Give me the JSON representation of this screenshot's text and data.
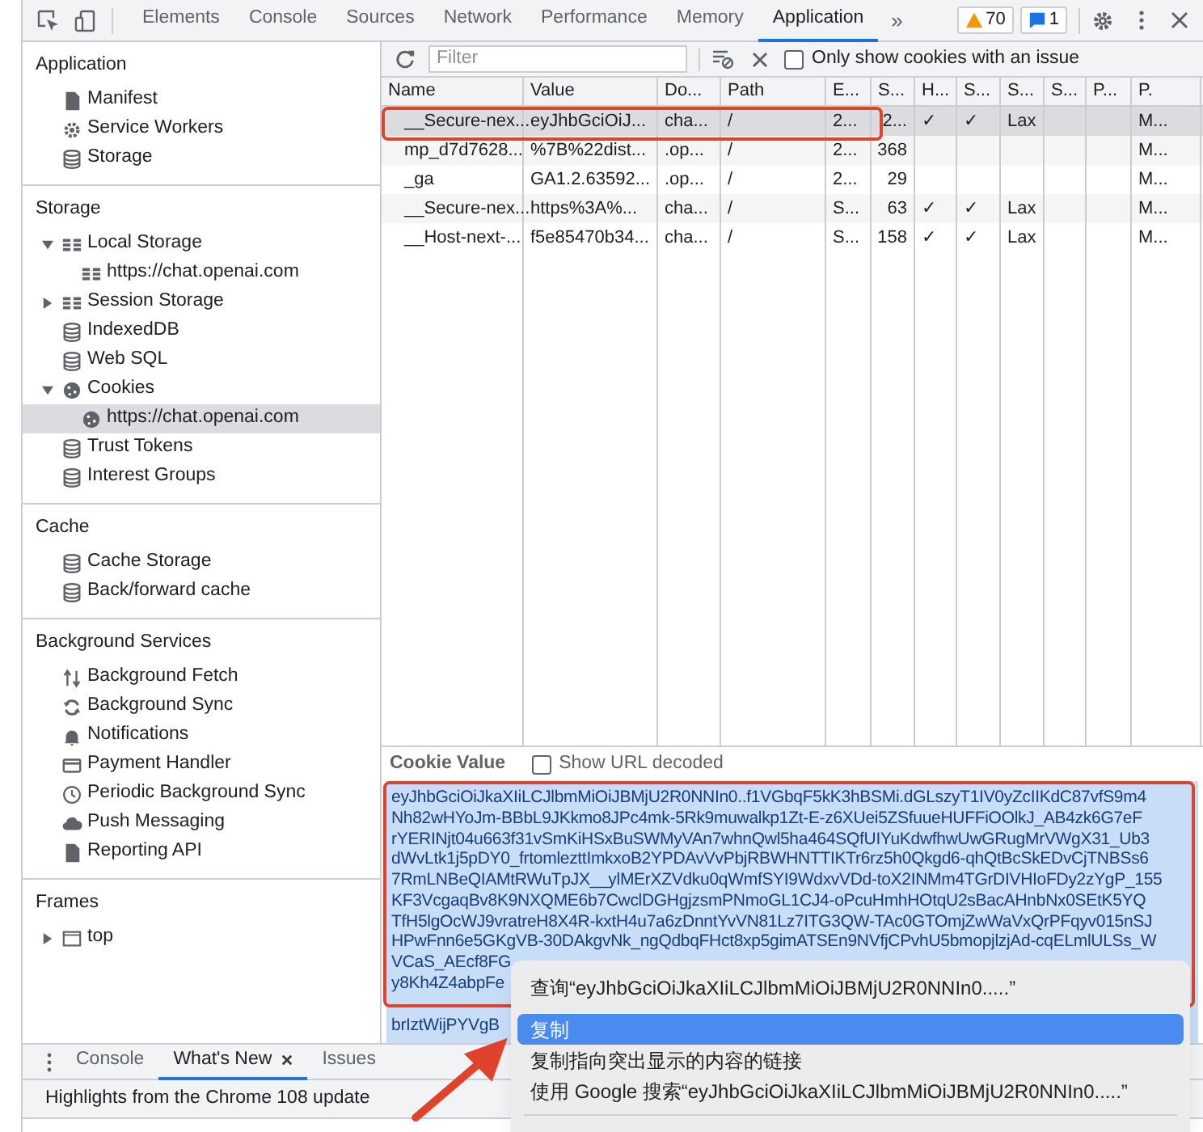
{
  "devtools_tabs": [
    {
      "label": "Elements",
      "selected": false
    },
    {
      "label": "Console",
      "selected": false
    },
    {
      "label": "Sources",
      "selected": false
    },
    {
      "label": "Network",
      "selected": false
    },
    {
      "label": "Performance",
      "selected": false
    },
    {
      "label": "Memory",
      "selected": false
    },
    {
      "label": "Application",
      "selected": true
    }
  ],
  "more_tabs": "»",
  "warning_count": "70",
  "message_count": "1",
  "sidebar": {
    "sections": [
      {
        "title": "Application",
        "items": [
          {
            "label": "Manifest",
            "kind": "file",
            "selected": false
          },
          {
            "label": "Service Workers",
            "kind": "gear",
            "selected": false
          },
          {
            "label": "Storage",
            "kind": "database",
            "selected": false
          }
        ]
      },
      {
        "title": "Storage",
        "items": [
          {
            "label": "Local Storage",
            "kind": "grid",
            "selected": false,
            "expanded": true,
            "children": [
              {
                "label": "https://chat.openai.com",
                "kind": "grid",
                "selected": false
              }
            ]
          },
          {
            "label": "Session Storage",
            "kind": "grid",
            "selected": false,
            "expanded": false
          },
          {
            "label": "IndexedDB",
            "kind": "database",
            "selected": false
          },
          {
            "label": "Web SQL",
            "kind": "database",
            "selected": false
          },
          {
            "label": "Cookies",
            "kind": "cookie",
            "selected": false,
            "expanded": true,
            "children": [
              {
                "label": "https://chat.openai.com",
                "kind": "cookie",
                "selected": true
              }
            ]
          },
          {
            "label": "Trust Tokens",
            "kind": "database",
            "selected": false
          },
          {
            "label": "Interest Groups",
            "kind": "database",
            "selected": false
          }
        ]
      },
      {
        "title": "Cache",
        "items": [
          {
            "label": "Cache Storage",
            "kind": "database",
            "selected": false
          },
          {
            "label": "Back/forward cache",
            "kind": "database",
            "selected": false
          }
        ]
      },
      {
        "title": "Background Services",
        "items": [
          {
            "label": "Background Fetch",
            "kind": "arrows",
            "selected": false
          },
          {
            "label": "Background Sync",
            "kind": "sync",
            "selected": false
          },
          {
            "label": "Notifications",
            "kind": "bell",
            "selected": false
          },
          {
            "label": "Payment Handler",
            "kind": "card",
            "selected": false
          },
          {
            "label": "Periodic Background Sync",
            "kind": "clock",
            "selected": false
          },
          {
            "label": "Push Messaging",
            "kind": "cloud",
            "selected": false
          },
          {
            "label": "Reporting API",
            "kind": "file",
            "selected": false
          }
        ]
      },
      {
        "title": "Frames",
        "items": [
          {
            "label": "top",
            "kind": "frame",
            "selected": false,
            "expanded": false
          }
        ]
      }
    ]
  },
  "toolbar": {
    "filter_placeholder": "Filter",
    "issue_checkbox": {
      "label": "Only show cookies with an issue",
      "checked": false
    }
  },
  "table": {
    "columns": [
      "Name",
      "Value",
      "Do...",
      "Path",
      "E...",
      "S...",
      "H...",
      "S...",
      "S...",
      "S...",
      "P...",
      "P."
    ],
    "rows": [
      {
        "selected": true,
        "cells": [
          "__Secure-nex...",
          "eyJhbGciOiJ...",
          "cha...",
          "/",
          "2...",
          "2...",
          "✓",
          "✓",
          "Lax",
          "",
          "",
          "M..."
        ]
      },
      {
        "selected": false,
        "cells": [
          "mp_d7d7628...",
          "%7B%22dist...",
          ".op...",
          "/",
          "2...",
          "368",
          "",
          "",
          "",
          "",
          "",
          "M..."
        ]
      },
      {
        "selected": false,
        "cells": [
          "_ga",
          "GA1.2.63592...",
          ".op...",
          "/",
          "2...",
          "29",
          "",
          "",
          "",
          "",
          "",
          "M..."
        ]
      },
      {
        "selected": false,
        "cells": [
          "__Secure-nex...",
          "https%3A%...",
          "cha...",
          "/",
          "S...",
          "63",
          "✓",
          "✓",
          "Lax",
          "",
          "",
          "M..."
        ]
      },
      {
        "selected": false,
        "cells": [
          "__Host-next-...",
          "f5e85470b34...",
          "cha...",
          "/",
          "S...",
          "158",
          "✓",
          "✓",
          "Lax",
          "",
          "",
          "M..."
        ]
      }
    ]
  },
  "cookie_value": {
    "title": "Cookie Value",
    "decode_checkbox": {
      "label": "Show URL decoded",
      "checked": false
    },
    "lines": [
      "eyJhbGciOiJkaXIiLCJlbmMiOiJBMjU2R0NNIn0..f1VGbqF5kK3hBSMi.dGLszyT1IV0yZcIIKdC87vfS9m4",
      "Nh82wHYoJm-BBbL9JKkmo8JPc4mk-5Rk9muwalkp1Zt-E-z6XUei5ZSfuueHUFFiOOlkJ_AB4zk6G7eF",
      "rYERINjt04u663f31vSmKiHSxBuSWMyVAn7whnQwl5ha464SQfUIYuKdwfhwUwGRugMrVWgX31_Ub3",
      "dWvLtk1j5pDY0_frtomlezttImkxoB2YPDAvVvPbjRBWHNTTIKTr6rz5h0Qkgd6-qhQtBcSkEDvCjTNBSs6",
      "7RmLNBeQIAMtRWuTpJX__ylMErXZVdku0qWmfSYI9WdxvVDd-toX2INMm4TGrDIVHIoFDy2zYgP_155",
      "KF3VcgaqBv8K9NXQME6b7CwclDGHgjzsmPNmoGL1CJ4-oPcuHmhHOtqU2sBacAHnbNx0SEtK5YQ",
      "TfH5lgOcWJ9vratreH8X4R-kxtH4u7a6zDnntYvVN81Lz7ITG3QW-TAc0GTOmjZwWaVxQrPFqyv015nSJ",
      "HPwFnn6e5GKgVB-30DAkgvNk_ngQdbqFHct8xp5gimATSEn9NVfjCPvhU5bmopjlzjAd-cqELmlULSs_W",
      "VCaS_AEcf8FG",
      "y8Kh4Z4abpFe",
      "brIztWijPYVgB"
    ]
  },
  "context_menu": {
    "items": [
      {
        "label": "查询“eyJhbGciOiJkaXIiLCJlbmMiOiJBMjU2R0NNIn0.....”",
        "selected": false
      },
      {
        "label": "复制",
        "selected": true
      },
      {
        "label": "复制指向突出显示的内容的链接",
        "selected": false
      },
      {
        "label": "使用 Google 搜索“eyJhbGciOiJkaXIiLCJlbmMiOiJBMjU2R0NNIn0.....”",
        "selected": false
      }
    ]
  },
  "drawer": {
    "tabs": [
      {
        "label": "Console",
        "selected": false,
        "closable": false
      },
      {
        "label": "What's New",
        "selected": true,
        "closable": true
      },
      {
        "label": "Issues",
        "selected": false,
        "closable": false
      }
    ],
    "message": "Highlights from the Chrome 108 update"
  }
}
